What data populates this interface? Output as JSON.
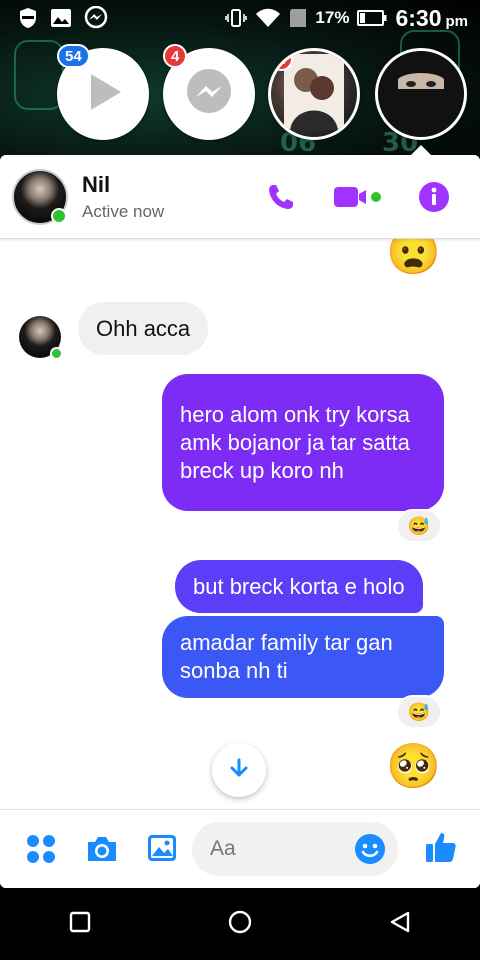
{
  "status_bar": {
    "battery_percent": "17%",
    "time": "6:30",
    "ampm": "pm"
  },
  "chat_heads": [
    {
      "name": "video-player",
      "badge": "54",
      "badge_color": "#1a73e8"
    },
    {
      "name": "messenger",
      "badge": "4",
      "badge_color": "#e53935"
    },
    {
      "name": "contact-photo",
      "badge": "2",
      "badge_color": "#e53935"
    },
    {
      "name": "active-contact",
      "badge": ""
    }
  ],
  "header": {
    "contact_name": "Nil",
    "status": "Active now",
    "accent_color": "#a033ff"
  },
  "messages": [
    {
      "direction": "incoming",
      "text": "Ohh acca"
    },
    {
      "direction": "outgoing",
      "text": "hero alom onk try korsa amk bojanor ja tar satta breck up koro nh",
      "reaction": "😅"
    },
    {
      "direction": "outgoing",
      "text": "but breck korta e holo"
    },
    {
      "direction": "outgoing",
      "text": "amadar family tar gan sonba nh ti",
      "reaction": "😅"
    }
  ],
  "emojis": {
    "top": "😦",
    "bottom": "🥺"
  },
  "composer": {
    "placeholder": "Aa",
    "accent_color": "#1a8cff"
  },
  "colors": {
    "bubble_purple": "#7d2cf5",
    "bubble_blue": "#3b58f6",
    "online": "#31c22f"
  }
}
